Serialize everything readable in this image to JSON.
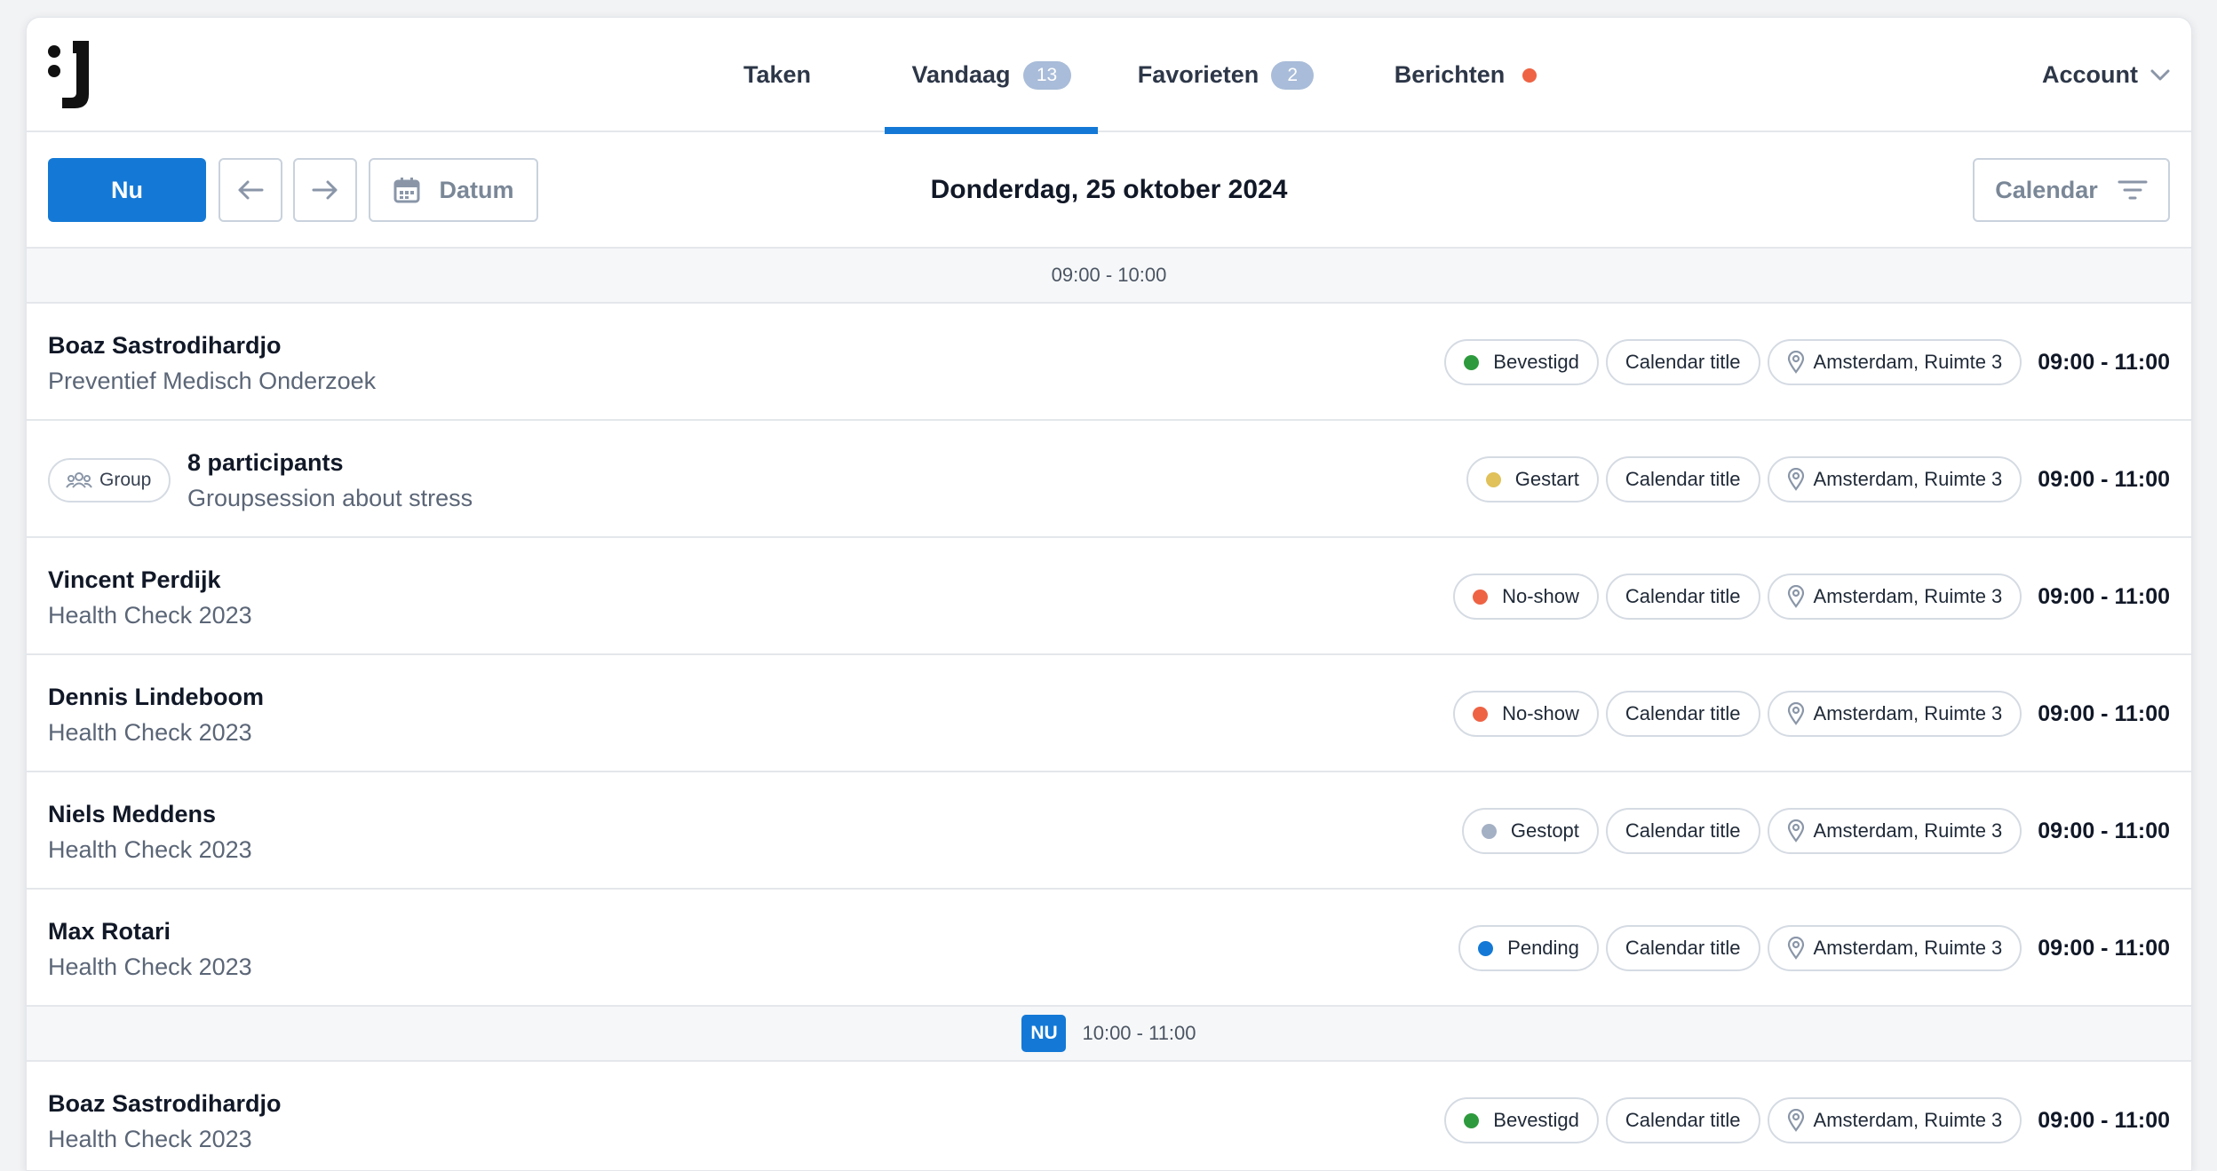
{
  "nav": {
    "tabs": [
      {
        "label": "Taken",
        "badge": ""
      },
      {
        "label": "Vandaag",
        "badge": "13"
      },
      {
        "label": "Favorieten",
        "badge": "2"
      },
      {
        "label": "Berichten",
        "badge": ""
      }
    ],
    "account_label": "Account"
  },
  "toolbar": {
    "now_label": "Nu",
    "date_label": "Datum",
    "current_date": "Donderdag, 25 oktober 2024",
    "calendar_filter_label": "Calendar"
  },
  "sections": [
    {
      "time_range": "09:00 - 10:00",
      "now_badge": ""
    },
    {
      "time_range": "10:00 - 11:00",
      "now_badge": "NU"
    }
  ],
  "group_chip_label": "Group",
  "appointments": [
    {
      "name": "Boaz Sastrodihardjo",
      "subtitle": "Preventief Medisch Onderzoek",
      "status": "Bevestigd",
      "status_color": "#2e9a3e",
      "calendar": "Calendar title",
      "location": "Amsterdam, Ruimte 3",
      "time": "09:00 - 11:00"
    },
    {
      "name": "8 participants",
      "subtitle": "Groupsession about stress",
      "status": "Gestart",
      "status_color": "#e0c15a",
      "calendar": "Calendar title",
      "location": "Amsterdam, Ruimte 3",
      "time": "09:00 - 11:00"
    },
    {
      "name": "Vincent Perdijk",
      "subtitle": "Health Check 2023",
      "status": "No-show",
      "status_color": "#ee6344",
      "calendar": "Calendar title",
      "location": "Amsterdam, Ruimte 3",
      "time": "09:00 - 11:00"
    },
    {
      "name": "Dennis Lindeboom",
      "subtitle": "Health Check 2023",
      "status": "No-show",
      "status_color": "#ee6344",
      "calendar": "Calendar title",
      "location": "Amsterdam, Ruimte 3",
      "time": "09:00 - 11:00"
    },
    {
      "name": "Niels Meddens",
      "subtitle": "Health Check 2023",
      "status": "Gestopt",
      "status_color": "#a4b0c4",
      "calendar": "Calendar title",
      "location": "Amsterdam, Ruimte 3",
      "time": "09:00 - 11:00"
    },
    {
      "name": "Max Rotari",
      "subtitle": "Health Check 2023",
      "status": "Pending",
      "status_color": "#1479d6",
      "calendar": "Calendar title",
      "location": "Amsterdam, Ruimte 3",
      "time": "09:00 - 11:00"
    },
    {
      "name": "Boaz Sastrodihardjo",
      "subtitle": "Health Check 2023",
      "status": "Bevestigd",
      "status_color": "#2e9a3e",
      "calendar": "Calendar title",
      "location": "Amsterdam, Ruimte 3",
      "time": "09:00 - 11:00"
    }
  ]
}
